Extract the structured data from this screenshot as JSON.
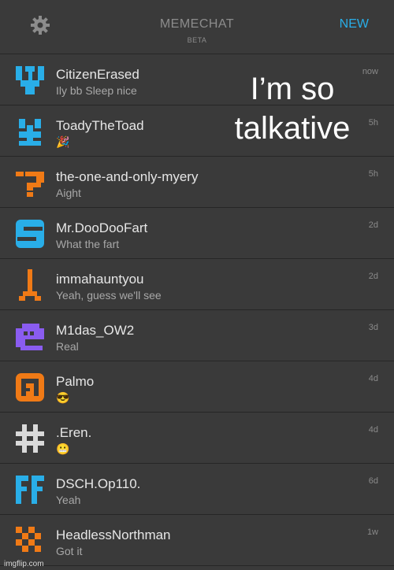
{
  "header": {
    "title": "MEMECHAT",
    "subtitle": "BETA",
    "new_label": "NEW",
    "settings_icon": "gear-icon",
    "accent": "#29aee8"
  },
  "chats": [
    {
      "name": "CitizenErased",
      "message": "Ily bb Sleep nice",
      "time": "now",
      "avatar_color": "#29aee8"
    },
    {
      "name": "ToadyTheToad",
      "message": "🎉",
      "time": "5h",
      "avatar_color": "#29aee8"
    },
    {
      "name": "the-one-and-only-myery",
      "message": "Aight",
      "time": "5h",
      "avatar_color": "#f07a16"
    },
    {
      "name": "Mr.DooDooFart",
      "message": "What the fart",
      "time": "2d",
      "avatar_color": "#29aee8"
    },
    {
      "name": "immahauntyou",
      "message": "Yeah, guess we'll see",
      "time": "2d",
      "avatar_color": "#f07a16"
    },
    {
      "name": "M1das_OW2",
      "message": "Real",
      "time": "3d",
      "avatar_color": "#8a5cf0"
    },
    {
      "name": "Palmo",
      "message": "😎",
      "time": "4d",
      "avatar_color": "#f07a16"
    },
    {
      "name": ".Eren.",
      "message": "😬",
      "time": "4d",
      "avatar_color": "#d9d9d9"
    },
    {
      "name": "DSCH.Op110.",
      "message": "Yeah",
      "time": "6d",
      "avatar_color": "#29aee8"
    },
    {
      "name": "HeadlessNorthman",
      "message": "Got it",
      "time": "1w",
      "avatar_color": "#f07a16"
    }
  ],
  "overlay_text": "I’m so talkative",
  "watermark": "imgflip.com"
}
